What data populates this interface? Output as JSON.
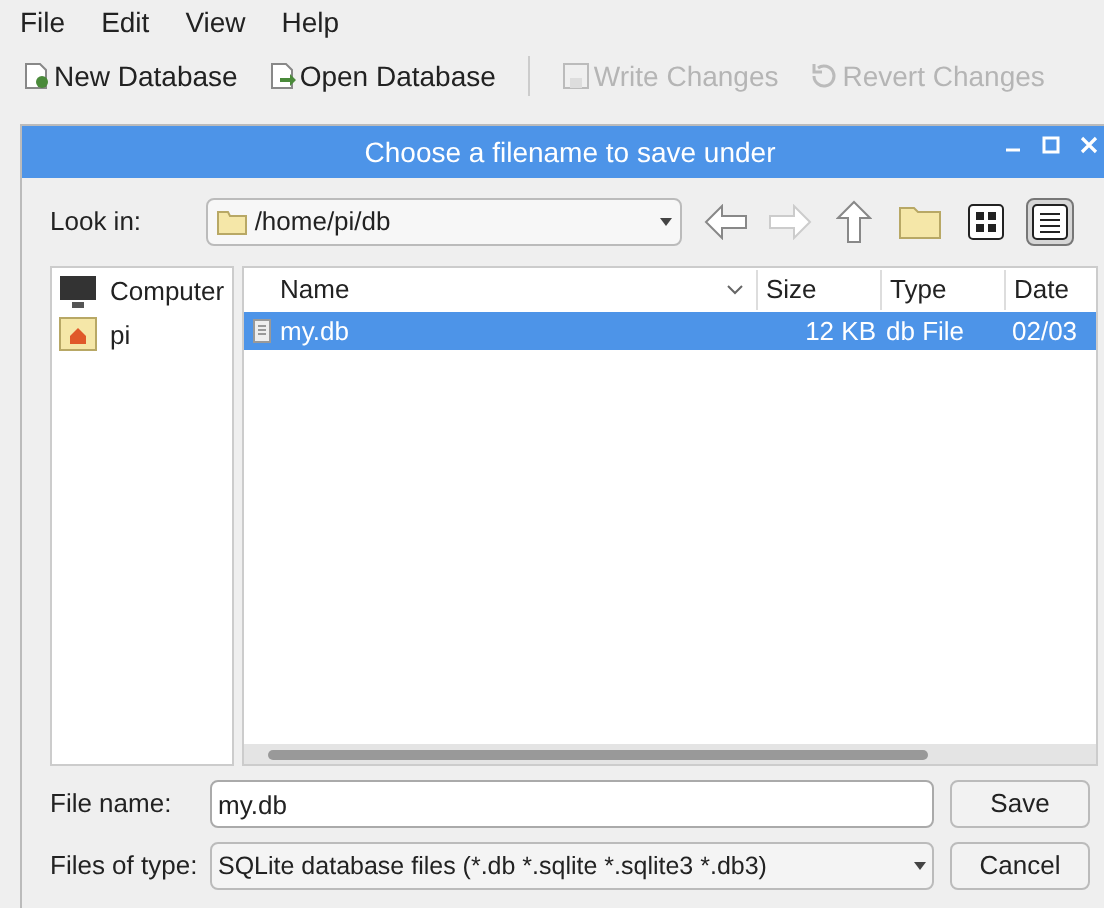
{
  "menu": [
    "File",
    "Edit",
    "View",
    "Help"
  ],
  "toolbar": [
    {
      "label": "New Database",
      "disabled": false,
      "kind": "new"
    },
    {
      "label": "Open Database",
      "disabled": false,
      "kind": "open"
    },
    {
      "label": "Write Changes",
      "disabled": true,
      "kind": "write"
    },
    {
      "label": "Revert Changes",
      "disabled": true,
      "kind": "revert"
    }
  ],
  "dialog": {
    "title": "Choose a filename to save under",
    "look_in": {
      "label": "Look in:",
      "value": "/home/pi/db"
    },
    "nav_buttons": [
      {
        "kind": "back",
        "disabled": false
      },
      {
        "kind": "forward",
        "disabled": true
      },
      {
        "kind": "up",
        "disabled": false
      },
      {
        "kind": "new-folder",
        "disabled": false
      },
      {
        "kind": "icon-view",
        "selected": false
      },
      {
        "kind": "detail-view",
        "selected": true
      }
    ],
    "sidebar": {
      "items": [
        {
          "label": "Computer",
          "kind": "computer",
          "selected": false
        },
        {
          "label": "pi",
          "kind": "home",
          "selected": false
        }
      ]
    },
    "table": {
      "columns": [
        "Name",
        "Size",
        "Type",
        "Date"
      ],
      "rows": [
        {
          "name": "my.db",
          "size": "12 KB",
          "type": "db File",
          "date": "02/03",
          "selected": true
        }
      ]
    },
    "file_name": {
      "label": "File name:",
      "value": "my.db"
    },
    "file_type": {
      "label": "Files of type:",
      "value": "SQLite database files (*.db *.sqlite *.sqlite3 *.db3)"
    },
    "buttons": [
      "Save",
      "Cancel"
    ]
  }
}
